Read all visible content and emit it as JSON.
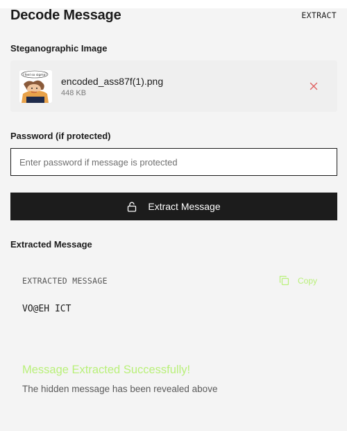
{
  "header": {
    "title": "Decode Message",
    "action_label": "EXTRACT"
  },
  "image_section": {
    "label": "Steganographic Image",
    "file": {
      "name": "encoded_ass87f(1).png",
      "size": "448 KB",
      "thumbnail_caption": "I feel so sigma!"
    },
    "remove_icon": "close-icon",
    "remove_color": "#e06060"
  },
  "password_section": {
    "label": "Password (if protected)",
    "value": "",
    "placeholder": "Enter password if message is protected"
  },
  "extract_button": {
    "label": "Extract Message",
    "icon": "lock-icon"
  },
  "result_section": {
    "label": "Extracted Message",
    "box_label": "EXTRACTED MESSAGE",
    "copy_label": "Copy",
    "copy_icon": "copy-icon",
    "message": "VO@EH ICT"
  },
  "status": {
    "title": "Message Extracted Successfully!",
    "subtitle": "The hidden message has been revealed above",
    "accent_color": "#b9f07a"
  }
}
